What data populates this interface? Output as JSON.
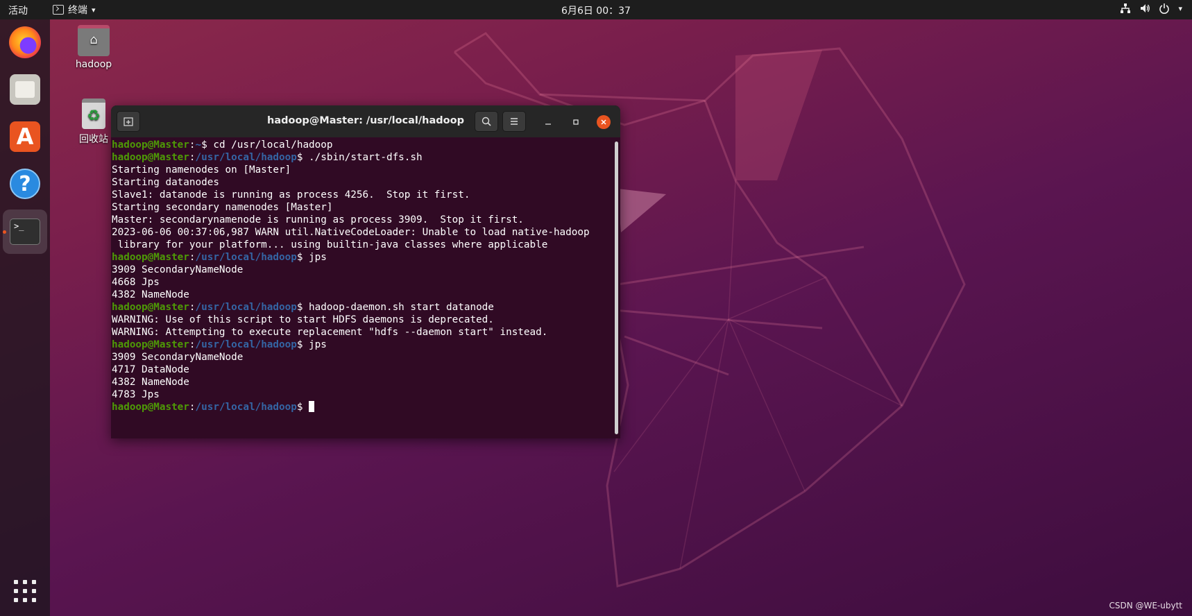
{
  "topbar": {
    "activities_label": "活动",
    "app_menu_label": "终端",
    "app_menu_caret": "▾",
    "clock": "6月6日  00：37"
  },
  "dock": {
    "items": [
      {
        "name": "Firefox",
        "icon": "firefox-icon"
      },
      {
        "name": "文件",
        "icon": "files-icon"
      },
      {
        "name": "Ubuntu Software",
        "icon": "software-icon",
        "glyph": "A"
      },
      {
        "name": "帮助",
        "icon": "help-icon",
        "glyph": "?"
      },
      {
        "name": "终端",
        "icon": "terminal-icon",
        "glyph": ">_",
        "active": true
      }
    ]
  },
  "desktop": {
    "icons": [
      {
        "label": "hadoop",
        "icon": "home-folder-icon"
      },
      {
        "label": "回收站",
        "icon": "trash-icon",
        "glyph": "♻"
      }
    ]
  },
  "terminal": {
    "title": "hadoop@Master: /usr/local/hadoop",
    "prompt_user": "hadoop@Master",
    "lines": [
      {
        "type": "prompt",
        "path": "~",
        "cmd": " cd /usr/local/hadoop"
      },
      {
        "type": "prompt",
        "path": "/usr/local/hadoop",
        "cmd": " ./sbin/start-dfs.sh"
      },
      {
        "type": "out",
        "text": "Starting namenodes on [Master]"
      },
      {
        "type": "out",
        "text": "Starting datanodes"
      },
      {
        "type": "out",
        "text": "Slave1: datanode is running as process 4256.  Stop it first."
      },
      {
        "type": "out",
        "text": "Starting secondary namenodes [Master]"
      },
      {
        "type": "out",
        "text": "Master: secondarynamenode is running as process 3909.  Stop it first."
      },
      {
        "type": "out",
        "text": "2023-06-06 00:37:06,987 WARN util.NativeCodeLoader: Unable to load native-hadoop"
      },
      {
        "type": "out",
        "text": " library for your platform... using builtin-java classes where applicable"
      },
      {
        "type": "prompt",
        "path": "/usr/local/hadoop",
        "cmd": " jps"
      },
      {
        "type": "out",
        "text": "3909 SecondaryNameNode"
      },
      {
        "type": "out",
        "text": "4668 Jps"
      },
      {
        "type": "out",
        "text": "4382 NameNode"
      },
      {
        "type": "prompt",
        "path": "/usr/local/hadoop",
        "cmd": " hadoop-daemon.sh start datanode"
      },
      {
        "type": "out",
        "text": "WARNING: Use of this script to start HDFS daemons is deprecated."
      },
      {
        "type": "out",
        "text": "WARNING: Attempting to execute replacement \"hdfs --daemon start\" instead."
      },
      {
        "type": "prompt",
        "path": "/usr/local/hadoop",
        "cmd": " jps"
      },
      {
        "type": "out",
        "text": "3909 SecondaryNameNode"
      },
      {
        "type": "out",
        "text": "4717 DataNode"
      },
      {
        "type": "out",
        "text": "4382 NameNode"
      },
      {
        "type": "out",
        "text": "4783 Jps"
      },
      {
        "type": "prompt",
        "path": "/usr/local/hadoop",
        "cmd": " ",
        "cursor": true
      }
    ]
  },
  "watermark": "CSDN @WE-ubytt",
  "colors": {
    "prompt_user": "#4e9a06",
    "prompt_path": "#3465a4",
    "terminal_bg": "#300a24",
    "accent": "#e95420"
  }
}
